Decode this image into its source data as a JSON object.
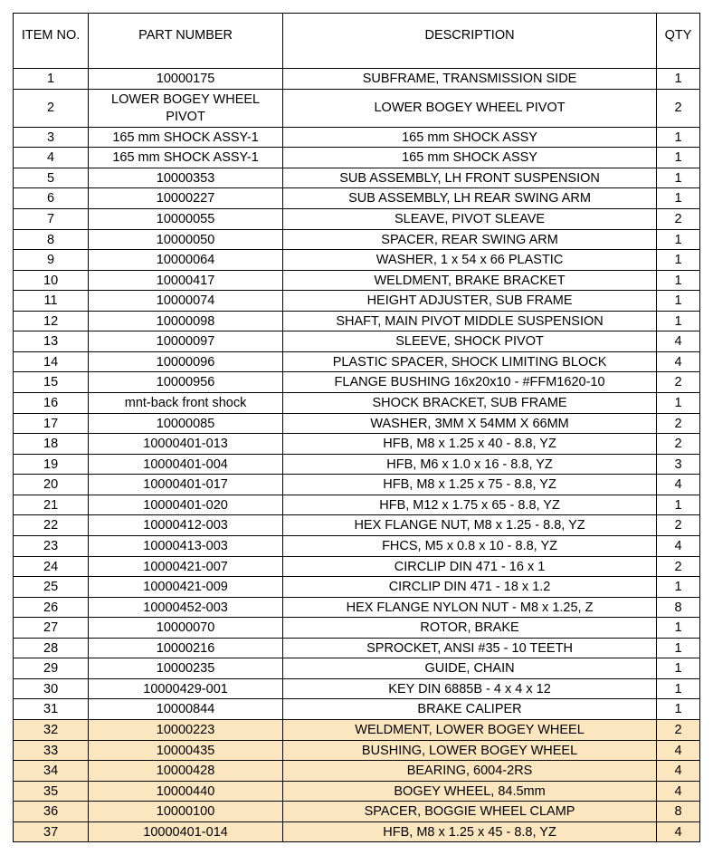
{
  "headers": {
    "item": "ITEM NO.",
    "part": "PART NUMBER",
    "desc": "DESCRIPTION",
    "qty": "QTY"
  },
  "rows": [
    {
      "item": "1",
      "part": "10000175",
      "desc": "SUBFRAME, TRANSMISSION SIDE",
      "qty": "1",
      "hi": false
    },
    {
      "item": "2",
      "part": "LOWER BOGEY WHEEL PIVOT",
      "desc": "LOWER BOGEY WHEEL PIVOT",
      "qty": "2",
      "hi": false
    },
    {
      "item": "3",
      "part": "165 mm SHOCK ASSY-1",
      "desc": "165 mm SHOCK ASSY",
      "qty": "1",
      "hi": false
    },
    {
      "item": "4",
      "part": "165 mm SHOCK ASSY-1",
      "desc": "165 mm SHOCK ASSY",
      "qty": "1",
      "hi": false
    },
    {
      "item": "5",
      "part": "10000353",
      "desc": "SUB ASSEMBLY, LH FRONT SUSPENSION",
      "qty": "1",
      "hi": false
    },
    {
      "item": "6",
      "part": "10000227",
      "desc": "SUB ASSEMBLY, LH REAR SWING ARM",
      "qty": "1",
      "hi": false
    },
    {
      "item": "7",
      "part": "10000055",
      "desc": "SLEAVE, PIVOT SLEAVE",
      "qty": "2",
      "hi": false
    },
    {
      "item": "8",
      "part": "10000050",
      "desc": "SPACER, REAR SWING ARM",
      "qty": "1",
      "hi": false
    },
    {
      "item": "9",
      "part": "10000064",
      "desc": "WASHER, 1 x 54 x 66 PLASTIC",
      "qty": "1",
      "hi": false
    },
    {
      "item": "10",
      "part": "10000417",
      "desc": "WELDMENT, BRAKE BRACKET",
      "qty": "1",
      "hi": false
    },
    {
      "item": "11",
      "part": "10000074",
      "desc": "HEIGHT ADJUSTER, SUB FRAME",
      "qty": "1",
      "hi": false
    },
    {
      "item": "12",
      "part": "10000098",
      "desc": "SHAFT, MAIN PIVOT MIDDLE SUSPENSION",
      "qty": "1",
      "hi": false
    },
    {
      "item": "13",
      "part": "10000097",
      "desc": "SLEEVE, SHOCK PIVOT",
      "qty": "4",
      "hi": false
    },
    {
      "item": "14",
      "part": "10000096",
      "desc": "PLASTIC SPACER, SHOCK LIMITING BLOCK",
      "qty": "4",
      "hi": false
    },
    {
      "item": "15",
      "part": "10000956",
      "desc": "FLANGE BUSHING 16x20x10 - #FFM1620-10",
      "qty": "2",
      "hi": false
    },
    {
      "item": "16",
      "part": "mnt-back front shock",
      "desc": "SHOCK BRACKET, SUB FRAME",
      "qty": "1",
      "hi": false
    },
    {
      "item": "17",
      "part": "10000085",
      "desc": "WASHER, 3MM X 54MM X 66MM",
      "qty": "2",
      "hi": false
    },
    {
      "item": "18",
      "part": "10000401-013",
      "desc": "HFB, M8 x 1.25 x 40 - 8.8, YZ",
      "qty": "2",
      "hi": false
    },
    {
      "item": "19",
      "part": "10000401-004",
      "desc": "HFB, M6 x 1.0 x 16 - 8.8, YZ",
      "qty": "3",
      "hi": false
    },
    {
      "item": "20",
      "part": "10000401-017",
      "desc": "HFB, M8 x 1.25 x 75 - 8.8, YZ",
      "qty": "4",
      "hi": false
    },
    {
      "item": "21",
      "part": "10000401-020",
      "desc": "HFB, M12 x 1.75 x 65 - 8.8, YZ",
      "qty": "1",
      "hi": false
    },
    {
      "item": "22",
      "part": "10000412-003",
      "desc": "HEX FLANGE NUT, M8 x 1.25 - 8.8, YZ",
      "qty": "2",
      "hi": false
    },
    {
      "item": "23",
      "part": "10000413-003",
      "desc": "FHCS, M5 x 0.8 x 10 - 8.8, YZ",
      "qty": "4",
      "hi": false
    },
    {
      "item": "24",
      "part": "10000421-007",
      "desc": "CIRCLIP DIN 471 - 16 x 1",
      "qty": "2",
      "hi": false
    },
    {
      "item": "25",
      "part": "10000421-009",
      "desc": "CIRCLIP DIN 471 - 18 x 1.2",
      "qty": "1",
      "hi": false
    },
    {
      "item": "26",
      "part": "10000452-003",
      "desc": "HEX FLANGE NYLON NUT - M8 x 1.25, Z",
      "qty": "8",
      "hi": false
    },
    {
      "item": "27",
      "part": "10000070",
      "desc": "ROTOR, BRAKE",
      "qty": "1",
      "hi": false
    },
    {
      "item": "28",
      "part": "10000216",
      "desc": "SPROCKET, ANSI #35 - 10 TEETH",
      "qty": "1",
      "hi": false
    },
    {
      "item": "29",
      "part": "10000235",
      "desc": "GUIDE, CHAIN",
      "qty": "1",
      "hi": false
    },
    {
      "item": "30",
      "part": "10000429-001",
      "desc": "KEY DIN 6885B - 4 x 4 x 12",
      "qty": "1",
      "hi": false
    },
    {
      "item": "31",
      "part": "10000844",
      "desc": "BRAKE CALIPER",
      "qty": "1",
      "hi": false
    },
    {
      "item": "32",
      "part": "10000223",
      "desc": "WELDMENT, LOWER BOGEY WHEEL",
      "qty": "2",
      "hi": true
    },
    {
      "item": "33",
      "part": "10000435",
      "desc": "BUSHING, LOWER BOGEY WHEEL",
      "qty": "4",
      "hi": true
    },
    {
      "item": "34",
      "part": "10000428",
      "desc": "BEARING, 6004-2RS",
      "qty": "4",
      "hi": true
    },
    {
      "item": "35",
      "part": "10000440",
      "desc": "BOGEY WHEEL, 84.5mm",
      "qty": "4",
      "hi": true
    },
    {
      "item": "36",
      "part": "10000100",
      "desc": "SPACER, BOGGIE WHEEL CLAMP",
      "qty": "8",
      "hi": true
    },
    {
      "item": "37",
      "part": "10000401-014",
      "desc": "HFB, M8 x 1.25 x 45 - 8.8, YZ",
      "qty": "4",
      "hi": true
    }
  ]
}
